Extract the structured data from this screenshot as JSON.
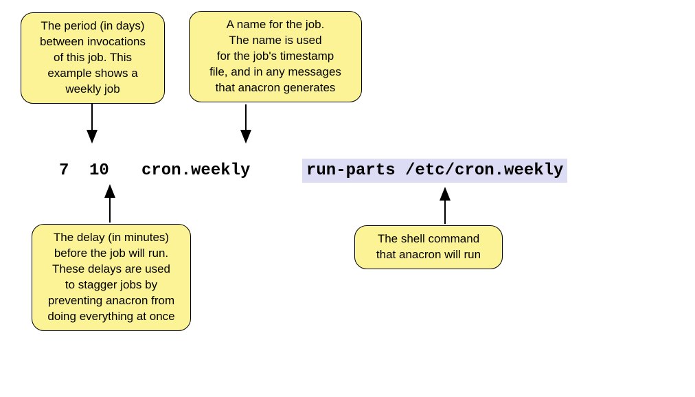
{
  "callouts": {
    "period": "The period (in days)\nbetween invocations\nof this job. This\nexample shows a\nweekly job",
    "jobname": "A name for the job.\nThe name is used\nfor the job's timestamp\nfile, and in any messages\nthat anacron generates",
    "delay": "The delay (in minutes)\nbefore the job will run.\nThese delays are used\nto stagger jobs by\npreventing anacron from\ndoing everything at once",
    "command": "The shell command\nthat anacron will run"
  },
  "code": {
    "period": "7",
    "delay": "10",
    "jobname": "cron.weekly",
    "command": "run-parts /etc/cron.weekly"
  }
}
